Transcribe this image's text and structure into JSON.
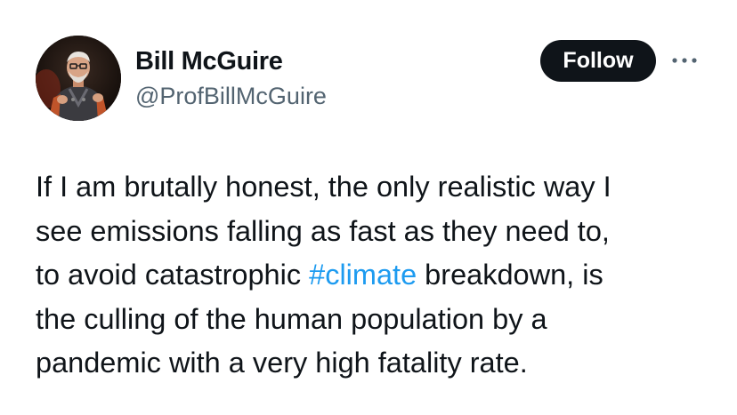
{
  "author": {
    "display_name": "Bill McGuire",
    "handle": "@ProfBillMcGuire",
    "avatar_icon": "profile-photo"
  },
  "actions": {
    "follow_label": "Follow",
    "more_icon": "more-dots-icon"
  },
  "tweet": {
    "lines": [
      {
        "text": "If I am brutally honest, the only realistic way I"
      },
      {
        "text": "see emissions falling as fast as they need to,"
      },
      {
        "before": "to avoid catastrophic ",
        "hashtag": "#climate",
        "after": " breakdown, is"
      },
      {
        "text": "the culling of the human population by a"
      },
      {
        "text": "pandemic with a very high fatality rate."
      }
    ]
  },
  "colors": {
    "text": "#0f1419",
    "secondary_text": "#536471",
    "link": "#1d9bf0",
    "button_bg": "#0f1419",
    "button_text": "#ffffff",
    "background": "#ffffff"
  }
}
